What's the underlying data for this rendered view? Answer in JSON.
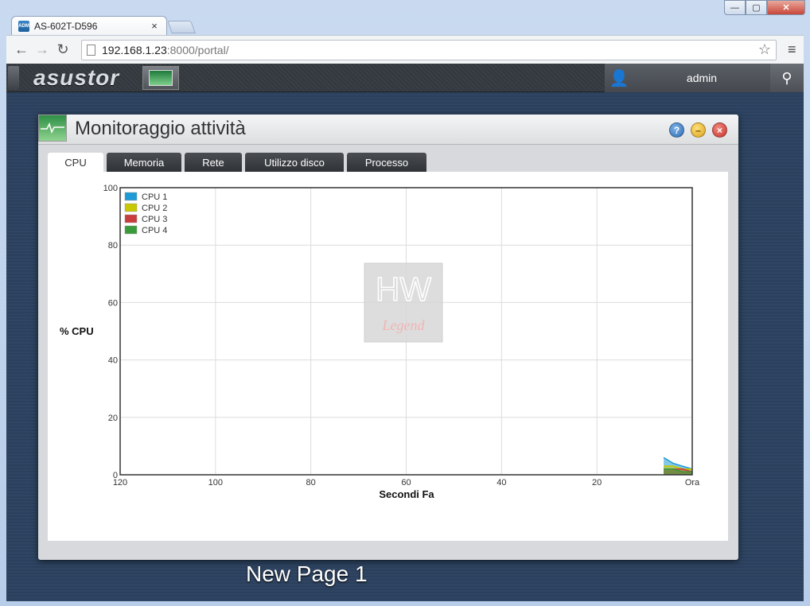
{
  "browser": {
    "tab_title": "AS-602T-D596",
    "tab_close": "×",
    "favicon_text": "ADM",
    "url_host": "192.168.1.23",
    "url_rest": ":8000/portal/",
    "back": "←",
    "forward": "→",
    "reload": "↻",
    "star": "☆",
    "menu": "≡",
    "win_min": "—",
    "win_max": "▢",
    "win_close": "✕"
  },
  "adm": {
    "logo": "asustor",
    "user": "admin",
    "user_icon": "👤",
    "search_icon": "⚲"
  },
  "window": {
    "title": "Monitoraggio attività",
    "help": "?",
    "minimize": "–",
    "close": "×",
    "tabs": [
      {
        "label": "CPU",
        "active": true
      },
      {
        "label": "Memoria",
        "active": false
      },
      {
        "label": "Rete",
        "active": false
      },
      {
        "label": "Utilizzo disco",
        "active": false
      },
      {
        "label": "Processo",
        "active": false
      }
    ]
  },
  "desktop_caption": "New Page 1",
  "chart_data": {
    "type": "area",
    "xlabel": "Secondi Fa",
    "ylabel": "% CPU",
    "x_ticks": [
      "120",
      "100",
      "80",
      "60",
      "40",
      "20",
      "Ora"
    ],
    "x_tick_values": [
      120,
      100,
      80,
      60,
      40,
      20,
      0
    ],
    "y_ticks": [
      0,
      20,
      40,
      60,
      80,
      100
    ],
    "xlim": [
      120,
      0
    ],
    "ylim": [
      0,
      100
    ],
    "grid": true,
    "legend_position": "top-left",
    "series": [
      {
        "name": "CPU 1",
        "color": "#1e9ad6",
        "x": [
          6,
          4,
          2,
          0
        ],
        "values": [
          6,
          4,
          3,
          2
        ]
      },
      {
        "name": "CPU 2",
        "color": "#c8c800",
        "x": [
          6,
          4,
          2,
          0
        ],
        "values": [
          3,
          3,
          2,
          2
        ]
      },
      {
        "name": "CPU 3",
        "color": "#c83c3c",
        "x": [
          6,
          4,
          2,
          0
        ],
        "values": [
          2,
          2,
          2,
          1
        ]
      },
      {
        "name": "CPU 4",
        "color": "#3a9a3a",
        "x": [
          6,
          4,
          2,
          0
        ],
        "values": [
          2,
          2,
          1,
          1
        ]
      }
    ]
  },
  "watermark": {
    "text_top": "HW",
    "text_bottom": "Legend"
  }
}
